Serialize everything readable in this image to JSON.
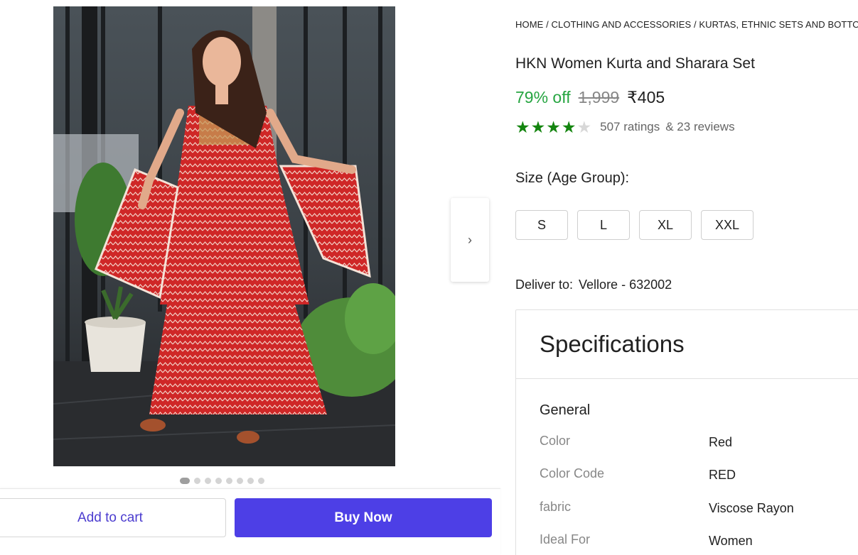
{
  "breadcrumb": "HOME / CLOTHING AND ACCESSORIES / KURTAS, ETHNIC SETS AND BOTTOMS",
  "product": {
    "title": "HKN Women Kurta and Sharara Set",
    "discount": "79% off",
    "mrp": "1,999",
    "price": "₹405",
    "rating_value": 4,
    "rating_max": 5,
    "ratings_text": "507 ratings",
    "reviews_text": "& 23 reviews"
  },
  "image": {
    "description_icon": "product-photo",
    "dots_count": 8,
    "active_dot": 1
  },
  "nav": {
    "next_icon": "›"
  },
  "size": {
    "label": "Size (Age Group):",
    "options": [
      "S",
      "L",
      "XL",
      "XXL"
    ]
  },
  "delivery": {
    "label": "Deliver to:",
    "location": "Vellore - 632002"
  },
  "actions": {
    "add_to_cart": "Add to cart",
    "buy_now": "Buy Now"
  },
  "specifications": {
    "title": "Specifications",
    "group": "General",
    "rows": [
      {
        "key": "Color",
        "value": "Red"
      },
      {
        "key": "Color Code",
        "value": "RED"
      },
      {
        "key": "fabric",
        "value": "Viscose Rayon"
      },
      {
        "key": "Ideal For",
        "value": "Women"
      }
    ]
  },
  "colors": {
    "discount_green": "#26a541",
    "star_green": "#14850f",
    "buy_button": "#4d3fe6",
    "cart_text": "#4b3ccf",
    "dress_red": "#d42a2a"
  }
}
